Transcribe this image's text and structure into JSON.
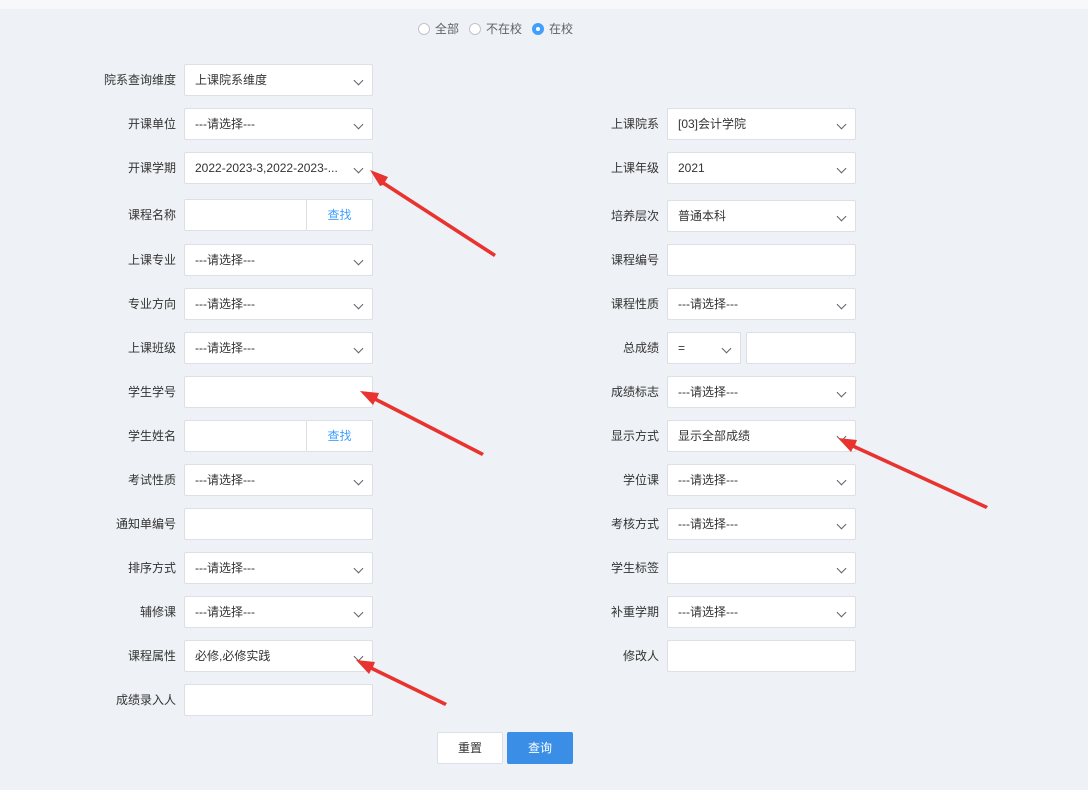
{
  "scope": {
    "options": [
      "全部",
      "不在校",
      "在校"
    ],
    "selected": "在校"
  },
  "left": [
    {
      "label": "院系查询维度",
      "kind": "select",
      "value": "上课院系维度"
    },
    {
      "label": "开课单位",
      "kind": "select",
      "value": "---请选择---"
    },
    {
      "label": "开课学期",
      "kind": "select",
      "value": "2022-2023-3,2022-2023-..."
    },
    {
      "label": "课程名称",
      "kind": "search",
      "value": "",
      "button": "查找"
    },
    {
      "label": "上课专业",
      "kind": "select",
      "value": "---请选择---"
    },
    {
      "label": "专业方向",
      "kind": "select",
      "value": "---请选择---"
    },
    {
      "label": "上课班级",
      "kind": "select",
      "value": "---请选择---"
    },
    {
      "label": "学生学号",
      "kind": "input",
      "value": ""
    },
    {
      "label": "学生姓名",
      "kind": "search",
      "value": "",
      "button": "查找"
    },
    {
      "label": "考试性质",
      "kind": "select",
      "value": "---请选择---"
    },
    {
      "label": "通知单编号",
      "kind": "input",
      "value": ""
    },
    {
      "label": "排序方式",
      "kind": "select",
      "value": "---请选择---"
    },
    {
      "label": "辅修课",
      "kind": "select",
      "value": "---请选择---"
    },
    {
      "label": "课程属性",
      "kind": "select",
      "value": "必修,必修实践"
    },
    {
      "label": "成绩录入人",
      "kind": "input",
      "value": ""
    }
  ],
  "right": [
    {
      "label": "上课院系",
      "kind": "select",
      "value": "[03]会计学院"
    },
    {
      "label": "上课年级",
      "kind": "select",
      "value": "2021"
    },
    {
      "label": "培养层次",
      "kind": "select",
      "value": "普通本科"
    },
    {
      "label": "课程编号",
      "kind": "input",
      "value": ""
    },
    {
      "label": "课程性质",
      "kind": "select",
      "value": "---请选择---"
    },
    {
      "label": "总成绩",
      "kind": "compare",
      "operator": "=",
      "value": ""
    },
    {
      "label": "成绩标志",
      "kind": "select",
      "value": "---请选择---"
    },
    {
      "label": "显示方式",
      "kind": "select",
      "value": "显示全部成绩"
    },
    {
      "label": "学位课",
      "kind": "select",
      "value": "---请选择---"
    },
    {
      "label": "考核方式",
      "kind": "select",
      "value": "---请选择---"
    },
    {
      "label": "学生标签",
      "kind": "select",
      "value": ""
    },
    {
      "label": "补重学期",
      "kind": "select",
      "value": "---请选择---"
    },
    {
      "label": "修改人",
      "kind": "input",
      "value": ""
    }
  ],
  "actions": {
    "reset": "重置",
    "query": "查询"
  },
  "annotation_color": "#e8332f",
  "accent_color": "#409eff"
}
